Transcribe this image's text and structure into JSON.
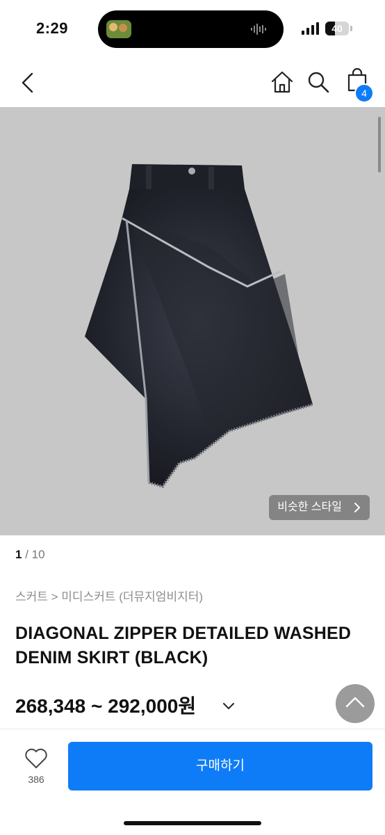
{
  "status": {
    "time": "2:29",
    "battery": "40"
  },
  "nav": {
    "cart_count": "4"
  },
  "hero": {
    "similar_label": "비슷한 스타일"
  },
  "gallery": {
    "current": "1",
    "total": " / 10"
  },
  "product": {
    "breadcrumb": "스커트 > 미디스커트 (더뮤지엄비지터)",
    "title": "DIAGONAL ZIPPER DETAILED WASHED DENIM SKIRT (BLACK)",
    "price": "268,348 ~ 292,000원"
  },
  "bottom": {
    "like_count": "386",
    "buy_label": "구매하기"
  },
  "colors": {
    "accent": "#0f7cf7",
    "image_bg": "#c7c7c7"
  }
}
